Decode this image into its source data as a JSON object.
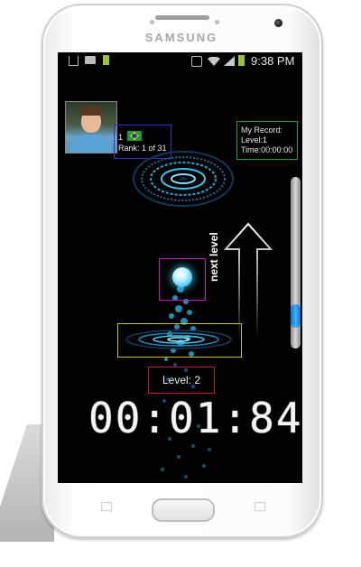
{
  "device": {
    "brand": "SAMSUNG"
  },
  "status_bar": {
    "time": "9:38 PM",
    "icons": [
      "usb-icon",
      "image-icon",
      "battery-icon",
      "mute-icon",
      "wifi-icon",
      "signal-icon",
      "battery-icon"
    ]
  },
  "player": {
    "rank_number": "1",
    "rank_text": "Rank: 1 of 31",
    "flag": "brazil-flag-icon"
  },
  "record": {
    "title": "My Record:",
    "level": "Level:1",
    "time": "Time:00:00:00"
  },
  "game": {
    "next_level_label": "next level",
    "level_label": "Level: 2",
    "timer": "00:01:84",
    "scroll_level": 0.86
  },
  "colors": {
    "accent_cyan": "#39b4ff",
    "player_box": "#2b2fd1",
    "record_box": "#1fa33a",
    "orb_box": "#c41db9",
    "portal_box": "#c9c61a",
    "level_box": "#c21b1b"
  }
}
